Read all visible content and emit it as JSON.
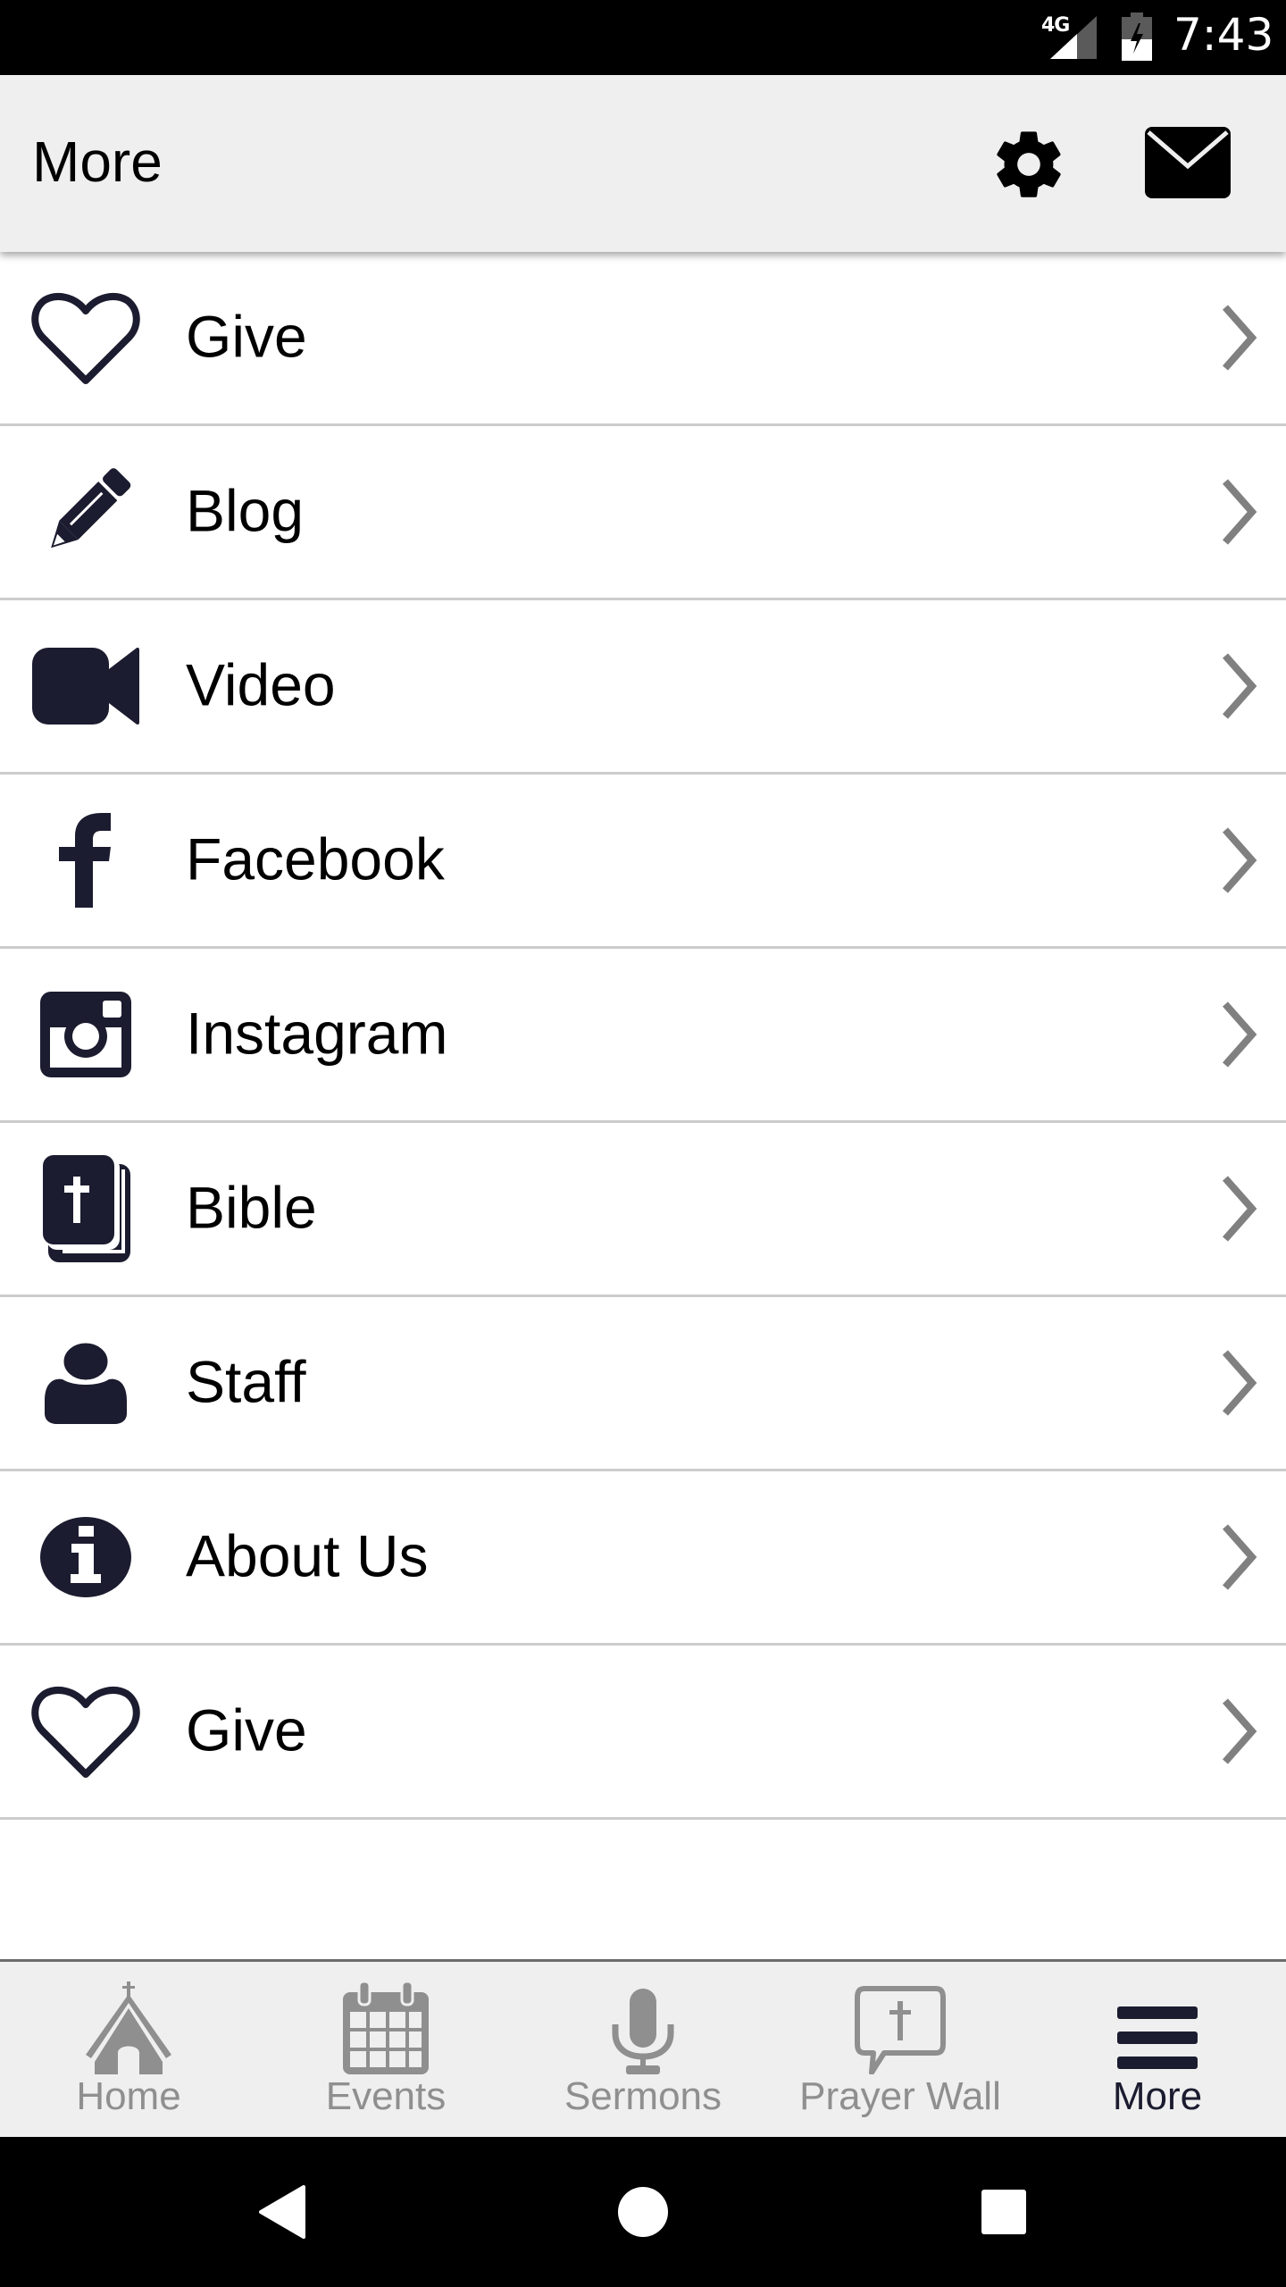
{
  "status_bar": {
    "network": "4G",
    "time": "7:43",
    "icons": [
      "signal-icon",
      "battery-charging-icon"
    ]
  },
  "app_bar": {
    "title": "More",
    "actions": [
      {
        "name": "settings",
        "icon": "gear-icon"
      },
      {
        "name": "messages",
        "icon": "envelope-icon"
      }
    ]
  },
  "menu": {
    "items": [
      {
        "label": "Give",
        "icon": "heart-icon"
      },
      {
        "label": "Blog",
        "icon": "pencil-icon"
      },
      {
        "label": "Video",
        "icon": "video-camera-icon"
      },
      {
        "label": "Facebook",
        "icon": "facebook-icon"
      },
      {
        "label": "Instagram",
        "icon": "instagram-icon"
      },
      {
        "label": "Bible",
        "icon": "bible-icon"
      },
      {
        "label": "Staff",
        "icon": "person-icon"
      },
      {
        "label": "About Us",
        "icon": "info-icon"
      },
      {
        "label": "Give",
        "icon": "heart-icon"
      }
    ],
    "chevron_icon": "chevron-right-icon"
  },
  "bottom_nav": {
    "tabs": [
      {
        "label": "Home",
        "icon": "church-icon",
        "active": false
      },
      {
        "label": "Events",
        "icon": "calendar-icon",
        "active": false
      },
      {
        "label": "Sermons",
        "icon": "microphone-icon",
        "active": false
      },
      {
        "label": "Prayer Wall",
        "icon": "prayer-bubble-icon",
        "active": false
      },
      {
        "label": "More",
        "icon": "hamburger-menu-icon",
        "active": true
      }
    ]
  },
  "system_nav": {
    "buttons": [
      "back",
      "home",
      "recents"
    ]
  },
  "colors": {
    "icon_dark": "#1c1c30",
    "inactive_gray": "#8f8f8f",
    "chevron_gray": "#808080",
    "app_bar_bg": "#efefef",
    "divider": "#cccccc"
  }
}
